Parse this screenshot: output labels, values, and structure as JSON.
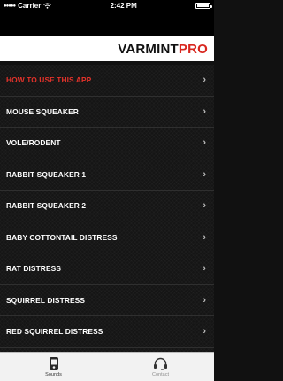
{
  "status_bar": {
    "carrier": "Carrier",
    "time": "2:42 PM",
    "battery_level": 1.0,
    "wifi_icon": "wifi-icon"
  },
  "brand": {
    "part1": "VARMINT",
    "part2": "PRO",
    "accent_color": "#d8271f"
  },
  "menu": {
    "items": [
      {
        "label": "HOW TO USE THIS APP",
        "active": true
      },
      {
        "label": "MOUSE SQUEAKER"
      },
      {
        "label": "VOLE/RODENT"
      },
      {
        "label": "RABBIT SQUEAKER 1"
      },
      {
        "label": "RABBIT SQUEAKER 2"
      },
      {
        "label": "BABY COTTONTAIL DISTRESS"
      },
      {
        "label": "RAT DISTRESS"
      },
      {
        "label": "SQUIRREL DISTRESS"
      },
      {
        "label": "RED SQUIRREL DISTRESS"
      }
    ],
    "chevron": "›"
  },
  "tabs": [
    {
      "label": "Sounds",
      "icon": "sounds-device-icon",
      "active": true
    },
    {
      "label": "Contact",
      "icon": "headset-icon",
      "active": false
    }
  ]
}
